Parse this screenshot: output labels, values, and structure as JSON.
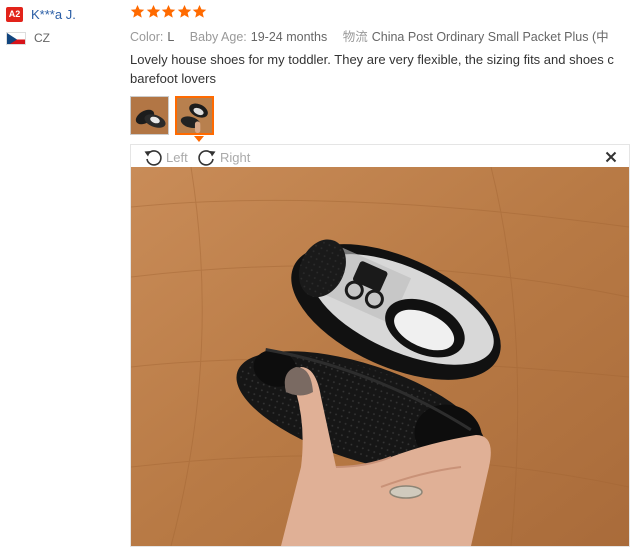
{
  "user": {
    "level_badge": "A2",
    "name": "K***a J.",
    "country": "CZ"
  },
  "review": {
    "stars": 5,
    "color_label": "Color:",
    "color_value": "L",
    "baby_age_label": "Baby Age:",
    "baby_age_value": "19-24 months",
    "shipping_label": "物流",
    "shipping_value": "China Post Ordinary Small Packet Plus (中",
    "text_line1": "Lovely house shoes for my toddler. They are very flexible, the sizing fits and shoes c",
    "text_line2": "barefoot lovers"
  },
  "viewer": {
    "rotate_left_label": "Left",
    "rotate_right_label": "Right"
  },
  "colors": {
    "accent": "#ff6a00",
    "star": "#ff6a00",
    "username": "#2a5ea6",
    "badge": "#e2231a"
  }
}
